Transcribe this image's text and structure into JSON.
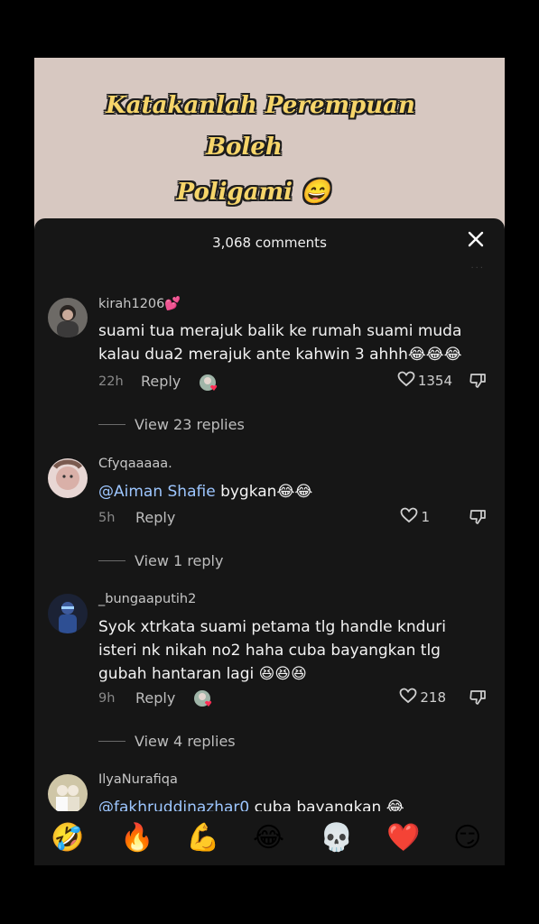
{
  "video": {
    "caption_line1": "Katakanlah Perempuan",
    "caption_line2": "Boleh",
    "caption_line3": "Poligami 😄"
  },
  "header": {
    "comment_count": "3,068 comments",
    "close_icon": "close-icon"
  },
  "comments": [
    {
      "username": "kirah1206💕",
      "text": "suami tua merajuk balik ke rumah suami muda kalau dua2 merajuk ante kahwin 3 ahhh😂😂😂",
      "time": "22h",
      "reply_label": "Reply",
      "likes": "1354",
      "view_replies": "View 23 replies"
    },
    {
      "username": "Cfyqaaaaa.",
      "mention": "@Aiman Shafie",
      "text": " bygkan😂😂",
      "time": "5h",
      "reply_label": "Reply",
      "likes": "1",
      "view_replies": "View 1 reply"
    },
    {
      "username": "_bungaaputih2",
      "text": "Syok xtrkata suami petama tlg handle knduri isteri nk nikah no2 haha cuba bayangkan tlg gubah hantaran lagi 😆😆😆",
      "time": "9h",
      "reply_label": "Reply",
      "likes": "218",
      "view_replies": "View 4 replies"
    },
    {
      "username": "IlyaNurafiqa",
      "mention": "@fakhruddinazhar0",
      "text": " cuba bayangkan 😂"
    }
  ],
  "emoji_bar": [
    "🤣",
    "🔥",
    "💪",
    "😂",
    "💀",
    "❤️",
    "😏"
  ],
  "colors": {
    "sheet_bg": "#161616",
    "video_bg": "#d7c8c1",
    "caption_fill": "#f6d56a",
    "mention": "#9dc6ff"
  }
}
